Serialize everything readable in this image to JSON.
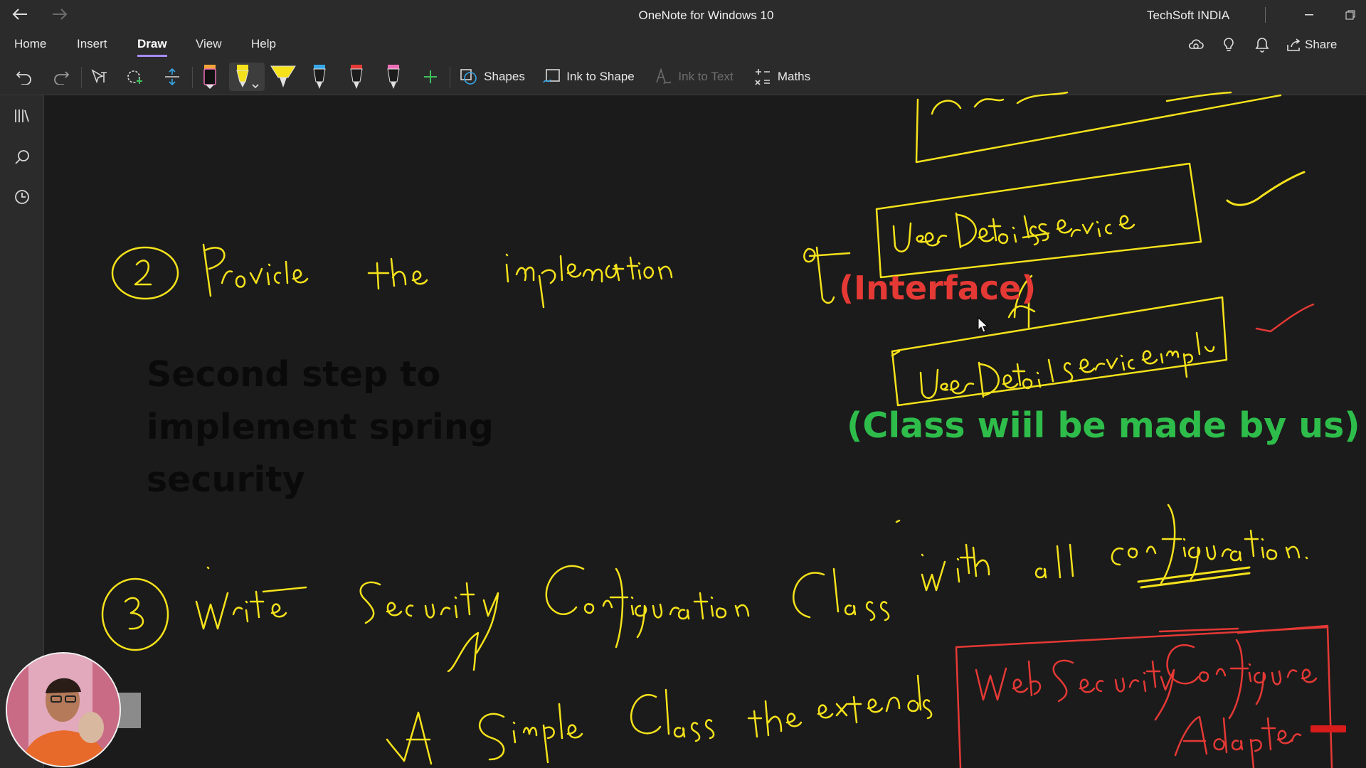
{
  "titlebar": {
    "app_title": "OneNote for Windows 10",
    "account": "TechSoft INDIA",
    "back_icon": "arrow-left-icon",
    "forward_icon": "arrow-right-icon"
  },
  "menu": {
    "tabs": [
      "Home",
      "Insert",
      "Draw",
      "View",
      "Help"
    ],
    "active_tab": "Draw",
    "share_label": "Share"
  },
  "ribbon": {
    "shapes_label": "Shapes",
    "ink_to_shape_label": "Ink to Shape",
    "ink_to_text_label": "Ink to Text",
    "maths_label": "Maths",
    "pens": [
      {
        "name": "black-pen",
        "color": "#111111"
      },
      {
        "name": "yellow-pen",
        "color": "#f5e21b"
      },
      {
        "name": "yellow-highlighter",
        "color": "#f5e21b"
      },
      {
        "name": "blue-pen",
        "color": "#36a7e8"
      },
      {
        "name": "red-pen",
        "color": "#e53935"
      },
      {
        "name": "pink-pen",
        "color": "#ec6fb8"
      }
    ]
  },
  "canvas": {
    "interface_note": "(Interface)",
    "class_note": "(Class wiil be made by us)",
    "step_note": [
      "Second step to",
      "implement spring",
      "security"
    ],
    "handwritten": {
      "step2": "Provide the implementation of",
      "box_interface": "UserDetailsService",
      "box_impl": "UserDetailServiceImpl",
      "step3": "Write Security Configuration Class with all configuration.",
      "simple_class": "A Simple Class the extends",
      "adapter_box": "WebSecurityConfigurerAdapter"
    }
  },
  "colors": {
    "ink_yellow": "#f5e21b",
    "ink_red": "#e53935",
    "accent": "#a78bff",
    "text_green": "#2ebd4b"
  }
}
